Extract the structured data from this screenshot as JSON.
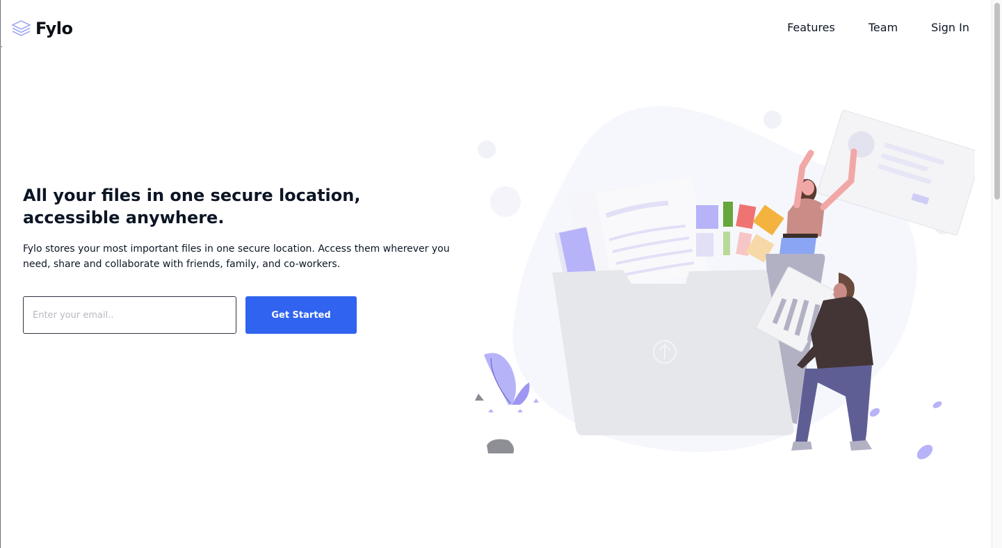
{
  "header": {
    "logo_text": "Fylo",
    "logo_icon": "stacked-layers-icon",
    "nav": [
      {
        "label": "Features"
      },
      {
        "label": "Team"
      },
      {
        "label": "Sign In"
      }
    ]
  },
  "hero": {
    "title": "All your files in one secure location, accessible anywhere.",
    "description": "Fylo stores your most important files in one secure location. Access them wherever you need, share and collaborate with friends, family, and co-workers.",
    "email_placeholder": "Enter your email..",
    "cta_label": "Get Started"
  },
  "colors": {
    "accent": "#3063f0",
    "heading": "#0c1524",
    "illustration_purple": "#b7b3f9",
    "folder": "#e6e7eb"
  }
}
